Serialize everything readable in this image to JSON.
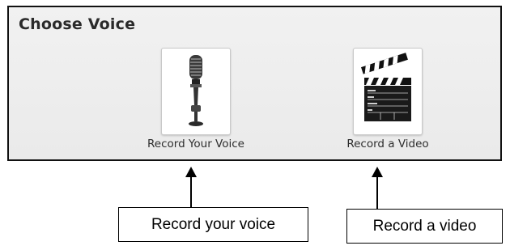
{
  "panel": {
    "title": "Choose Voice"
  },
  "options": [
    {
      "label": "Record Your Voice",
      "icon": "microphone-icon"
    },
    {
      "label": "Record a Video",
      "icon": "clapperboard-icon"
    }
  ],
  "callouts": {
    "voice": "Record your voice",
    "video": "Record a video"
  },
  "colors": {
    "panel_border": "#111111",
    "panel_background": "#eeeeee",
    "arrow": "#000000"
  }
}
